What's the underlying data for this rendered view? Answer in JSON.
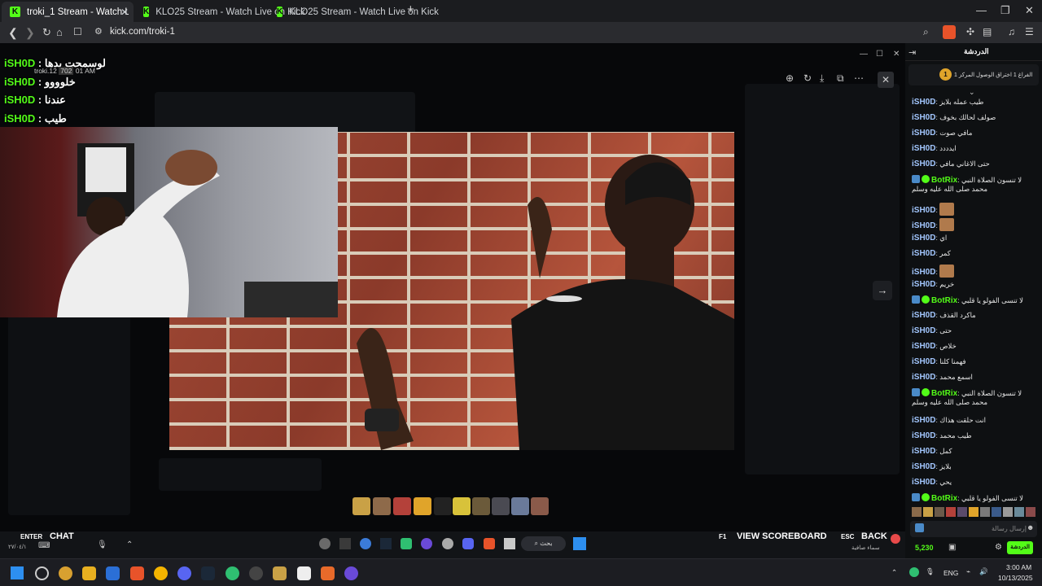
{
  "browser": {
    "tabs": [
      {
        "label": "troki_1 Stream - Watch Live on K",
        "active": true
      },
      {
        "label": "KLO25 Stream - Watch Live on Kick",
        "active": false
      },
      {
        "label": "KLO25 Stream - Watch Live on Kick",
        "active": false
      }
    ],
    "url": "kick.com/troki-1",
    "new_tab": "+"
  },
  "overlay_chat": [
    {
      "user": "iSH0D",
      "text": "لوسمحت بدها"
    },
    {
      "user": "iSH0D",
      "text": "خلوووو"
    },
    {
      "user": "iSH0D",
      "text": "عندنا"
    },
    {
      "user": "iSH0D",
      "text": "طيب"
    }
  ],
  "overlay_popup": {
    "user": "troki.12",
    "count": "702",
    "time": "01 AM"
  },
  "game_hud": {
    "enter_key": "ENTER",
    "chat_label": "CHAT",
    "f1_key": "F1",
    "scoreboard_label": "VIEW SCOREBOARD",
    "esc_key": "ESC",
    "back_label": "BACK",
    "search_text": "بحث",
    "weather": "سماء صافية",
    "bottom_left_date": "٢٧/٠٤/١"
  },
  "chat": {
    "title": "الدردشة",
    "pinned": "الفراغ 1 اختراق الوصول المركز 1",
    "pinned_num": "1",
    "messages": [
      {
        "user": "iSH0D",
        "text": "طيب عمله بلايز",
        "bot": false
      },
      {
        "user": "iSH0D",
        "text": "صولف لحالك بخوف",
        "bot": false
      },
      {
        "user": "iSH0D",
        "text": "مافي صوت",
        "bot": false
      },
      {
        "user": "iSH0D",
        "text": "ايدددد",
        "bot": false
      },
      {
        "user": "iSH0D",
        "text": "حتى الاغاني مافي",
        "bot": false
      },
      {
        "user": "BotRix",
        "text": "لا تنسون الصلاة النبي محمد صلى الله عليه وسلم",
        "bot": true
      },
      {
        "user": "iSH0D",
        "text": "",
        "bot": false,
        "avatar": true
      },
      {
        "user": "iSH0D",
        "text": "",
        "bot": false,
        "avatar": true
      },
      {
        "user": "iSH0D",
        "text": "اي",
        "bot": false
      },
      {
        "user": "iSH0D",
        "text": "كمر",
        "bot": false
      },
      {
        "user": "iSH0D",
        "text": "",
        "bot": false,
        "avatar": true
      },
      {
        "user": "iSH0D",
        "text": "خريم",
        "bot": false
      },
      {
        "user": "BotRix",
        "text": "لا تنسى الفولو يا قلبي",
        "bot": true
      },
      {
        "user": "iSH0D",
        "text": "ماكرد القذف",
        "bot": false
      },
      {
        "user": "iSH0D",
        "text": "حتى",
        "bot": false
      },
      {
        "user": "iSH0D",
        "text": "خلاص",
        "bot": false
      },
      {
        "user": "iSH0D",
        "text": "فهمنا كلنا",
        "bot": false
      },
      {
        "user": "iSH0D",
        "text": "اسمع محمد",
        "bot": false
      },
      {
        "user": "BotRix",
        "text": "لا تنسون الصلاة النبي محمد صلى الله عليه وسلم",
        "bot": true
      },
      {
        "user": "iSH0D",
        "text": "انت حلقت هذاك",
        "bot": false
      },
      {
        "user": "iSH0D",
        "text": "طيب محمد",
        "bot": false
      },
      {
        "user": "iSH0D",
        "text": "كمل",
        "bot": false
      },
      {
        "user": "iSH0D",
        "text": "بلايز",
        "bot": false
      },
      {
        "user": "iSH0D",
        "text": "يحي",
        "bot": false
      },
      {
        "user": "BotRix",
        "text": "لا تنسى الفولو يا قلبي",
        "bot": true
      }
    ],
    "input_placeholder": "إرسال رسالة",
    "points": "5,230",
    "send_label": "الدردشة"
  },
  "taskbar": {
    "time": "3:00 AM",
    "date": "10/13/2025",
    "lang": "ENG"
  },
  "colors": {
    "kick_green": "#53fc18",
    "username_blue": "#a3c7ff"
  }
}
